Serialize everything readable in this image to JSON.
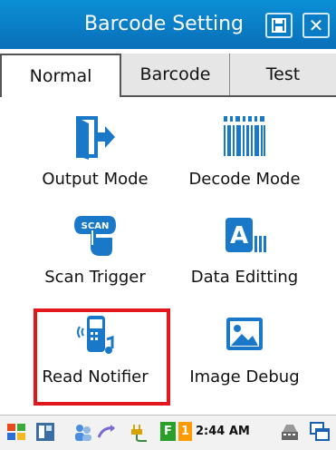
{
  "window": {
    "title": "Barcode Setting"
  },
  "tabs": [
    {
      "label": "Normal",
      "active": true
    },
    {
      "label": "Barcode",
      "active": false
    },
    {
      "label": "Test",
      "active": false
    }
  ],
  "grid": [
    {
      "label": "Output Mode",
      "icon": "output-mode-icon"
    },
    {
      "label": "Decode Mode",
      "icon": "barcode-icon"
    },
    {
      "label": "Scan Trigger",
      "icon": "scan-trigger-icon"
    },
    {
      "label": "Data Editting",
      "icon": "data-editing-icon"
    },
    {
      "label": "Read Notifier",
      "icon": "read-notifier-icon",
      "highlighted": true
    },
    {
      "label": "Image Debug",
      "icon": "image-debug-icon"
    }
  ],
  "taskbar": {
    "time": "2:44 AM",
    "badge_f": "F",
    "badge_1": "1"
  },
  "colors": {
    "titlebar": "#0a7cc6",
    "icon_blue": "#1a78c8",
    "highlight": "#e2171b"
  }
}
